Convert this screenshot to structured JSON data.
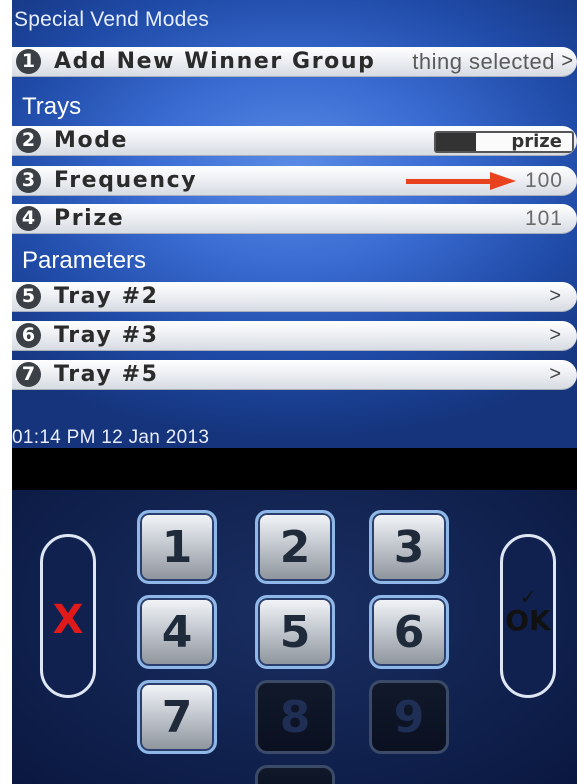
{
  "header": {
    "title": "Special Vend Modes"
  },
  "rows_top": [
    {
      "number": "1",
      "label": "Add New Winner Group",
      "value": "thing selected",
      "chevron": ">"
    }
  ],
  "sections": {
    "trays": "Trays",
    "parameters": "Parameters"
  },
  "tray_rows": [
    {
      "number": "2",
      "label": "Mode",
      "toggle_value": "prize"
    },
    {
      "number": "3",
      "label": "Frequency",
      "value": "100"
    },
    {
      "number": "4",
      "label": "Prize",
      "value": "101"
    }
  ],
  "parameter_rows": [
    {
      "number": "5",
      "label": "Tray #2",
      "chevron": ">"
    },
    {
      "number": "6",
      "label": "Tray #3",
      "chevron": ">"
    },
    {
      "number": "7",
      "label": "Tray #5",
      "chevron": ">"
    }
  ],
  "status": {
    "datetime": "01:14 PM 12 Jan 2013"
  },
  "keypad": {
    "cancel_label": "X",
    "ok_check": "✓",
    "ok_label": "OK",
    "keys": [
      "1",
      "2",
      "3",
      "4",
      "5",
      "6",
      "7",
      "8",
      "9"
    ]
  },
  "colors": {
    "arrow": "#e8421e",
    "cancel": "#e01a1a",
    "screen_accent": "#3a6cd2"
  }
}
